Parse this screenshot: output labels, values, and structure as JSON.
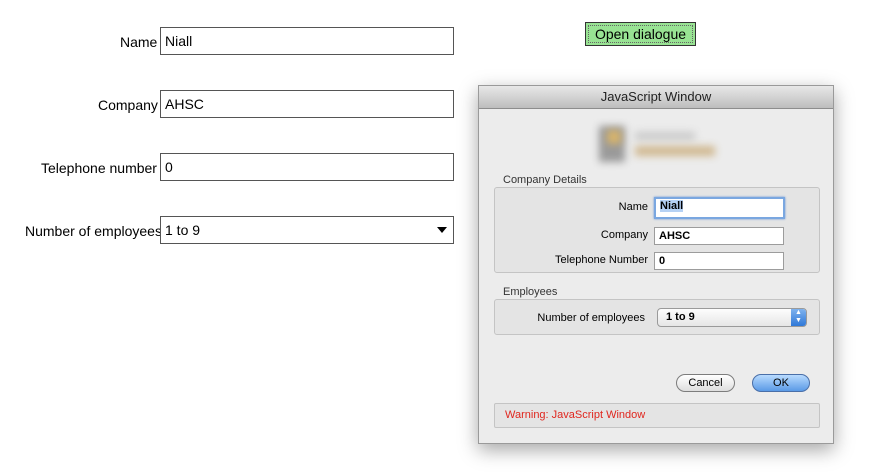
{
  "form": {
    "name_label": "Name",
    "name_value": "Niall",
    "company_label": "Company",
    "company_value": "AHSC",
    "telephone_label": "Telephone number",
    "telephone_value": "0",
    "employees_label": "Number of employees",
    "employees_value": "1 to 9"
  },
  "open_button_label": "Open dialogue",
  "dialog": {
    "title": "JavaScript Window",
    "company_group_label": "Company Details",
    "name_label": "Name",
    "name_value": "Niall",
    "company_label": "Company",
    "company_value": "AHSC",
    "telephone_label": "Telephone Number",
    "telephone_value": "0",
    "employees_group_label": "Employees",
    "employees_label": "Number of employees",
    "employees_value": "1 to 9",
    "cancel_label": "Cancel",
    "ok_label": "OK",
    "warning": "Warning: JavaScript Window"
  },
  "colors": {
    "open_button_bg": "#98e393",
    "warning_text": "#e0261e",
    "ok_button": "#5a9ae6"
  }
}
